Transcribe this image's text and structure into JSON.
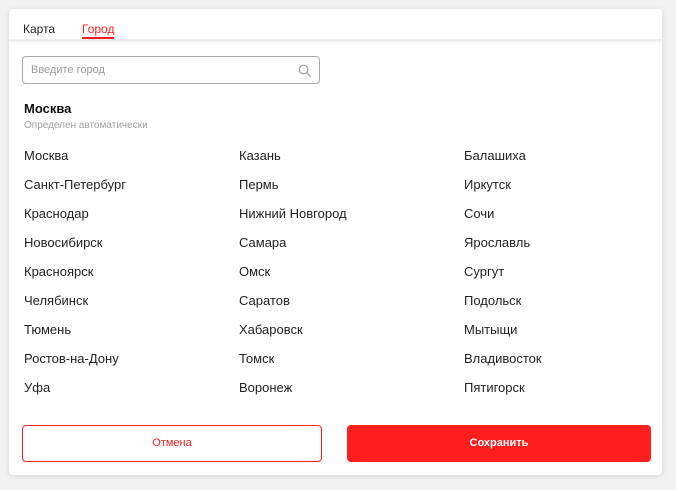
{
  "tabs": [
    {
      "label": "Карта",
      "active": false
    },
    {
      "label": "Город",
      "active": true
    }
  ],
  "search": {
    "placeholder": "Введите город",
    "value": ""
  },
  "current": {
    "city": "Москва",
    "note": "Определен автоматически"
  },
  "cities": {
    "column1": [
      "Москва",
      "Санкт-Петербург",
      "Краснодар",
      "Новосибирск",
      "Красноярск",
      "Челябинск",
      "Тюмень",
      "Ростов-на-Дону",
      "Уфа"
    ],
    "column2": [
      "Казань",
      "Пермь",
      "Нижний Новгород",
      "Самара",
      "Омск",
      "Саратов",
      "Хабаровск",
      "Томск",
      "Воронеж"
    ],
    "column3": [
      "Балашиха",
      "Иркутск",
      "Сочи",
      "Ярославль",
      "Сургут",
      "Подольск",
      "Мытыщи",
      "Владивосток",
      "Пятигорск"
    ]
  },
  "buttons": {
    "cancel_label": "Отмена",
    "save_label": "Сохранить"
  },
  "colors": {
    "accent": "#ff1e1e",
    "text": "#222222",
    "muted": "#a0a0a0"
  },
  "icons": {
    "search": "search-icon"
  }
}
